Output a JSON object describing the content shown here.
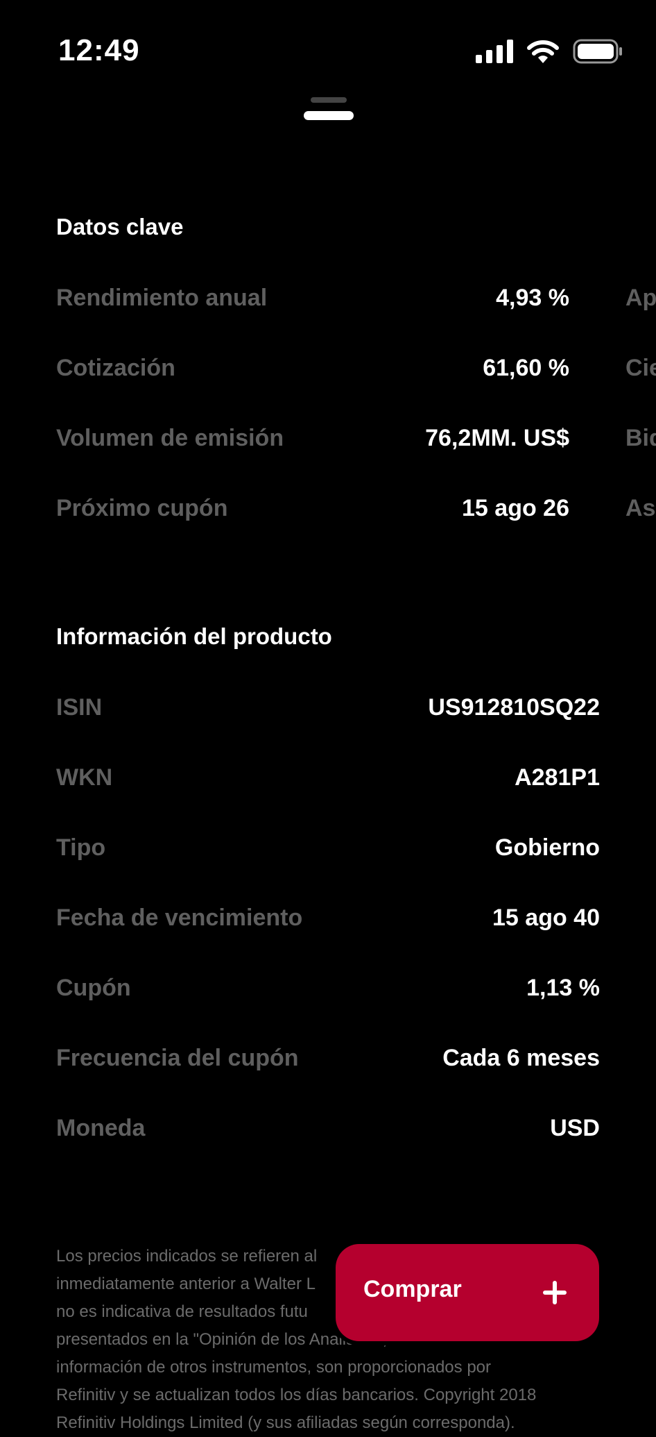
{
  "status_bar": {
    "time": "12:49"
  },
  "icons": {
    "signal": "signal-icon",
    "wifi": "wifi-icon",
    "battery": "battery-icon",
    "grabber": "sheet-grabber",
    "plus": "plus-icon"
  },
  "colors": {
    "background": "#000000",
    "label": "#5f5f5f",
    "value": "#ffffff",
    "accent": "#b5002e",
    "disclaimer": "#6b6b6b"
  },
  "key_data": {
    "title": "Datos clave",
    "rows": [
      {
        "label": "Rendimiento anual",
        "value": "4,93 %",
        "next_label": "Ap"
      },
      {
        "label": "Cotización",
        "value": "61,60 %",
        "next_label": "Cie"
      },
      {
        "label": "Volumen de emisión",
        "value": "76,2MM. US$",
        "next_label": "Bid"
      },
      {
        "label": "Próximo cupón",
        "value": "15 ago 26",
        "next_label": "As"
      }
    ]
  },
  "product_info": {
    "title": "Información del producto",
    "rows": [
      {
        "label": "ISIN",
        "value": "US912810SQ22"
      },
      {
        "label": "WKN",
        "value": "A281P1"
      },
      {
        "label": "Tipo",
        "value": "Gobierno"
      },
      {
        "label": "Fecha de vencimiento",
        "value": "15 ago 40"
      },
      {
        "label": "Cupón",
        "value": "1,13 %"
      },
      {
        "label": "Frecuencia del cupón",
        "value": "Cada 6 meses"
      },
      {
        "label": "Moneda",
        "value": "USD"
      }
    ]
  },
  "disclaimer": {
    "lines": [
      "Los precios indicados se refieren al",
      "inmediatamente anterior a Walter L",
      "no es indicativa de resultados futu",
      "presentados en la \"Opinión de los Analistas\", así como la",
      "información de otros instrumentos, son proporcionados por",
      "Refinitiv y se actualizan todos los días bancarios. Copyright 2018",
      "Refinitiv Holdings Limited (y sus afiliadas según corresponda)."
    ]
  },
  "buy_button": {
    "label": "Comprar"
  }
}
